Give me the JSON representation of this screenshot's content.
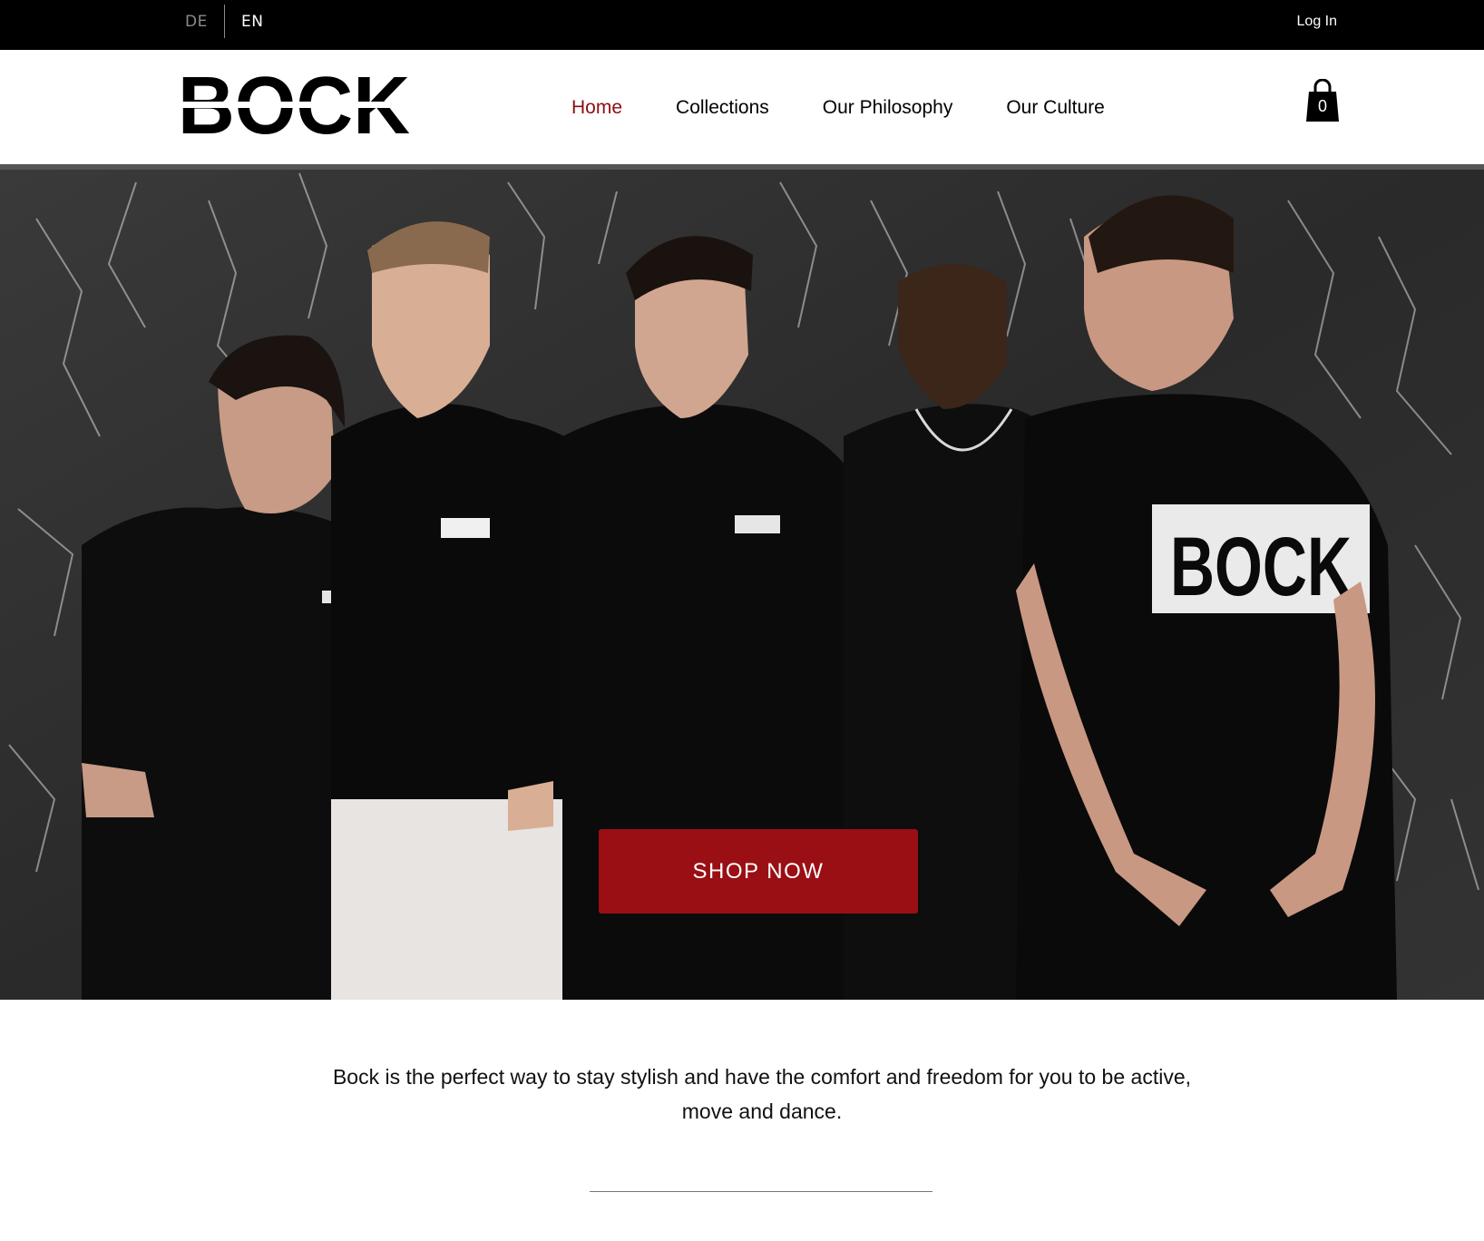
{
  "topbar": {
    "languages": [
      "DE",
      "EN"
    ],
    "active_language": "EN",
    "login_label": "Log In"
  },
  "header": {
    "logo_text": "BOCK",
    "nav": [
      {
        "label": "Home",
        "active": true
      },
      {
        "label": "Collections",
        "active": false
      },
      {
        "label": "Our Philosophy",
        "active": false
      },
      {
        "label": "Our Culture",
        "active": false
      }
    ],
    "cart_count": "0",
    "cart_icon": "shopping-bag-icon"
  },
  "hero": {
    "image": "group-of-five-people-in-black-bock-shirts",
    "shirt_print": "BOCK",
    "cta_label": "SHOP NOW"
  },
  "intro": {
    "text": "Bock is the perfect way to stay stylish and have the comfort and freedom for you to be active, move and dance."
  },
  "colors": {
    "accent": "#8b0e12",
    "button": "#9a0f14",
    "topbar": "#000000"
  }
}
